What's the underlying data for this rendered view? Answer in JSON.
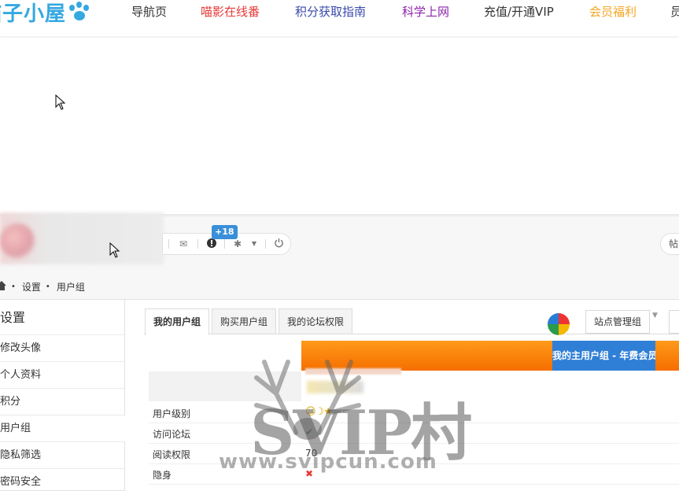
{
  "nav": {
    "logo": "喵子小屋",
    "items": [
      {
        "label": "导航页",
        "color": "#333333"
      },
      {
        "label": "喵影在线番",
        "color": "#e53935"
      },
      {
        "label": "积分获取指南",
        "color": "#3949ab"
      },
      {
        "label": "科学上网",
        "color": "#8e24aa"
      },
      {
        "label": "充值/开通VIP",
        "color": "#333333"
      },
      {
        "label": "会员福利",
        "color": "#f5a623"
      },
      {
        "label": "员",
        "color": "#333333"
      }
    ]
  },
  "userbar": {
    "badge": "+18",
    "right_pill": "帖"
  },
  "breadcrumb": [
    "设置",
    "用户组"
  ],
  "sidebar": {
    "title": "设置",
    "items": [
      "修改头像",
      "个人资料",
      "积分",
      "用户组",
      "隐私筛选",
      "密码安全"
    ],
    "active_index": 3
  },
  "tabs": [
    "我的用户组",
    "购买用户组",
    "我的论坛权限"
  ],
  "site_manage": "站点管理组",
  "table": {
    "header_group": "我的主用户组 - 年费会员",
    "rows": [
      {
        "label": "用户级别",
        "value": "☺☽★"
      },
      {
        "label": "访问论坛",
        "value": "✔"
      },
      {
        "label": "阅读权限",
        "value": "70"
      },
      {
        "label": "隐身",
        "value": "✖"
      }
    ]
  },
  "watermark": {
    "main": "SVIP村",
    "sub": "www.svipcun.com"
  }
}
